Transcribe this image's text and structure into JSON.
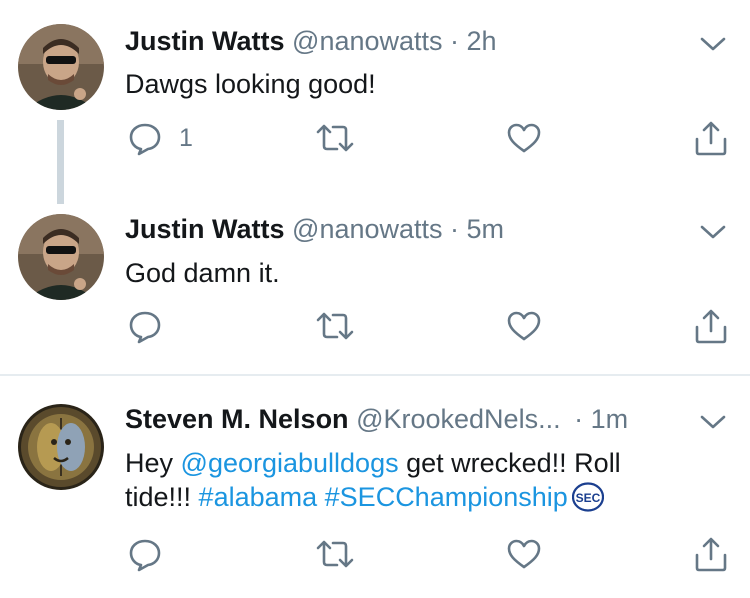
{
  "tweets": [
    {
      "name": "Justin Watts",
      "handle": "@nanowatts",
      "time": "· 2h",
      "text": "Dawgs looking good!",
      "reply_count": "1"
    },
    {
      "name": "Justin Watts",
      "handle": "@nanowatts",
      "time": "· 5m",
      "text": "God damn it.",
      "reply_count": ""
    },
    {
      "name": "Steven M. Nelson",
      "handle": "@KrookedNels...",
      "time": "· 1m",
      "text_parts": {
        "t1": "Hey ",
        "mention": "@georgiabulldogs",
        "t2": " get wrecked!! Roll tide!!! ",
        "hashtag1": "#alabama",
        "t3": " ",
        "hashtag2": "#SECChampionship"
      },
      "reply_count": ""
    }
  ],
  "sec_logo_text": "SEC",
  "icons": [
    "reply-icon",
    "retweet-icon",
    "like-icon",
    "share-icon",
    "chevron-down-icon"
  ],
  "colors": {
    "link": "#1b95e0",
    "secondary": "#657786",
    "icon": "#657786",
    "thread_line": "#ccd6dd"
  }
}
